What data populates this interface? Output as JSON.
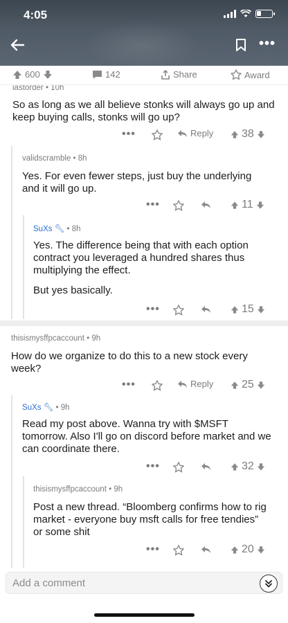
{
  "status_bar": {
    "time": "4:05"
  },
  "post_bar": {
    "upvotes": "600",
    "comments": "142",
    "share_label": "Share",
    "award_label": "Award"
  },
  "comments": [
    {
      "author": "iastorder",
      "age": "10h",
      "text": "So as long as we all believe stonks will always go up and keep buying calls, stonks will go up?",
      "reply_label": "Reply",
      "score": "38"
    },
    {
      "author": "validscramble",
      "age": "8h",
      "text": "Yes. For even fewer steps, just buy the underlying and it will go up.",
      "score": "11"
    },
    {
      "author": "SuXs",
      "age": "8h",
      "text": "Yes. The difference being that with each option contract you leveraged a hundred shares thus multiplying the effect.",
      "text2": "But yes basically.",
      "score": "15"
    },
    {
      "author": "thisismysffpcaccount",
      "age": "9h",
      "text": "How do we organize to do this to a new stock every week?",
      "reply_label": "Reply",
      "score": "25"
    },
    {
      "author": "SuXs",
      "age": "9h",
      "text": "Read my post above. Wanna try with $MSFT tomorrow. Also I'll go on discord before market and we can coordinate there.",
      "score": "32"
    },
    {
      "author": "thisismysffpcaccount",
      "age": "9h",
      "text": "Post a new thread.  “Bloomberg confirms how to rig market - everyone buy msft calls for free tendies” or some shit",
      "score": "20"
    }
  ],
  "comment_box": {
    "placeholder": "Add a comment"
  },
  "colors": {
    "header_bg": "#4f5a66",
    "username_blue": "#2b6fd1",
    "divider": "#eeeeee"
  },
  "icons": [
    "back-arrow-icon",
    "bookmark-icon",
    "more-icon",
    "upvote-icon",
    "downvote-icon",
    "comment-icon",
    "share-icon",
    "award-icon",
    "reply-icon",
    "wrench-icon",
    "double-chevron-down-icon"
  ]
}
